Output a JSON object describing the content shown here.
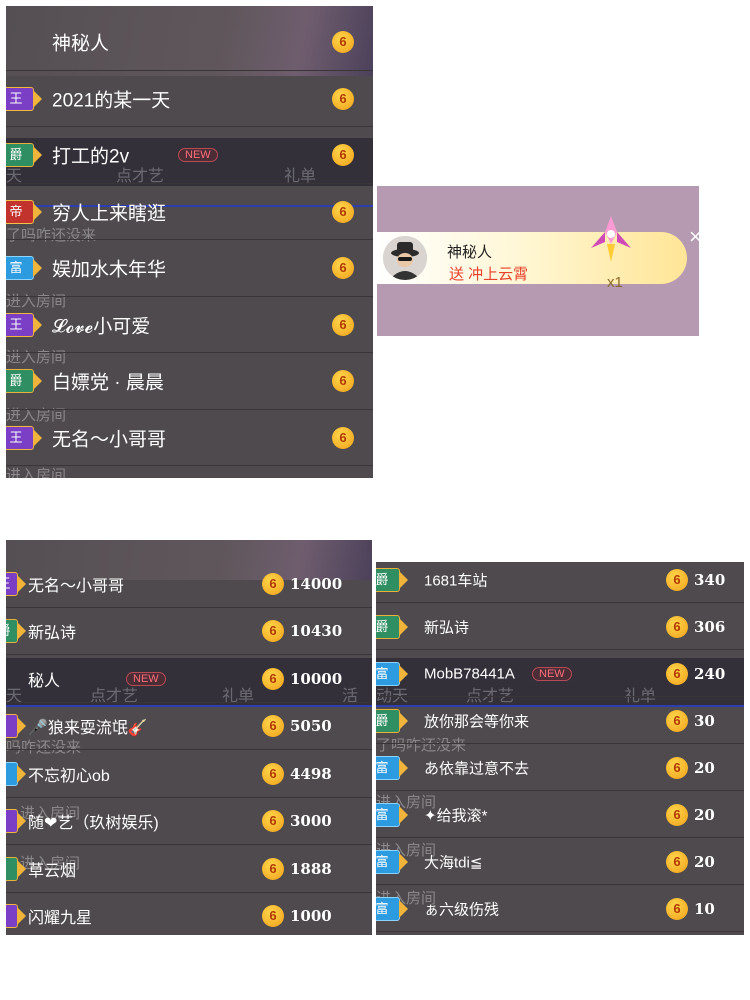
{
  "panel_top": {
    "rows": [
      {
        "badge": "",
        "badge_type": "",
        "name": "神秘人",
        "new": false
      },
      {
        "badge": "王",
        "badge_type": "wang",
        "name": "2021的某一天",
        "new": false
      },
      {
        "badge": "爵",
        "badge_type": "jue",
        "name": "打工的2v",
        "new": true
      },
      {
        "badge": "帝",
        "badge_type": "di",
        "name": "穷人上来瞎逛",
        "new": false
      },
      {
        "badge": "富",
        "badge_type": "fu",
        "name": "娱加水木年华",
        "new": false
      },
      {
        "badge": "王",
        "badge_type": "wang",
        "name": "𝓛𝓸𝓿𝓮小可爱",
        "new": false
      },
      {
        "badge": "爵",
        "badge_type": "jue",
        "name": "白嫖党 · 晨晨",
        "new": false
      },
      {
        "badge": "王",
        "badge_type": "wang",
        "name": "无名～小哥哥",
        "new": false
      }
    ],
    "coin_glyph": "6",
    "new_label": "NEW",
    "tabs": [
      "天",
      "点才艺",
      "礼单"
    ],
    "ghost_lines": [
      "了吗咋还没来",
      "进入房间",
      "进入房间",
      "进入房间",
      "进入房间"
    ]
  },
  "gift": {
    "sender": "神秘人",
    "action": "送 冲上云霄",
    "count": "x1",
    "close": "×"
  },
  "panel_left": {
    "rows": [
      {
        "badge": "王",
        "badge_type": "wang",
        "name": "无名～小哥哥",
        "value": "14000",
        "new": false
      },
      {
        "badge": "爵",
        "badge_type": "jue",
        "name": "新弘诗",
        "value": "10430",
        "new": false
      },
      {
        "badge": "",
        "badge_type": "",
        "name": "秘人",
        "value": "10000",
        "new": true
      },
      {
        "badge": "",
        "badge_type": "wang",
        "name": "🎤狼来耍流氓🎸",
        "value": "5050",
        "new": false
      },
      {
        "badge": "",
        "badge_type": "fu",
        "name": "不忘初心ob",
        "value": "4498",
        "new": false
      },
      {
        "badge": "",
        "badge_type": "wang",
        "name": "随❤艺（玖树娱乐)",
        "value": "3000",
        "new": false
      },
      {
        "badge": "",
        "badge_type": "jue",
        "name": "草云烟",
        "value": "1888",
        "new": false
      },
      {
        "badge": "",
        "badge_type": "wang",
        "name": "闪耀九星",
        "value": "1000",
        "new": false
      }
    ],
    "tabs": [
      "天",
      "点才艺",
      "礼单",
      "活"
    ],
    "ghost_lines": [
      "吗咋还没来",
      "进入房间",
      "进入房间"
    ]
  },
  "panel_right": {
    "rows": [
      {
        "badge": "爵",
        "badge_type": "jue",
        "name": "1681车站",
        "value": "340",
        "new": false
      },
      {
        "badge": "爵",
        "badge_type": "jue",
        "name": "新弘诗",
        "value": "306",
        "new": false
      },
      {
        "badge": "富",
        "badge_type": "fu",
        "name": "MobB78441A",
        "value": "240",
        "new": true
      },
      {
        "badge": "爵",
        "badge_type": "jue",
        "name": "放你那会等你来",
        "value": "30",
        "new": false
      },
      {
        "badge": "富",
        "badge_type": "fu",
        "name": "あ依靠过意不去",
        "value": "20",
        "new": false
      },
      {
        "badge": "富",
        "badge_type": "fu",
        "name": "✦给我滚*",
        "value": "20",
        "new": false
      },
      {
        "badge": "富",
        "badge_type": "fu",
        "name": "大海tdi≦",
        "value": "20",
        "new": false
      },
      {
        "badge": "富",
        "badge_type": "fu",
        "name": "ぁ六级伤残",
        "value": "10",
        "new": false
      }
    ],
    "tabs": [
      "动天",
      "点才艺",
      "礼单"
    ],
    "ghost_lines": [
      "了吗咋还没来",
      "进入房间",
      "进入房间",
      "进入房间"
    ]
  }
}
